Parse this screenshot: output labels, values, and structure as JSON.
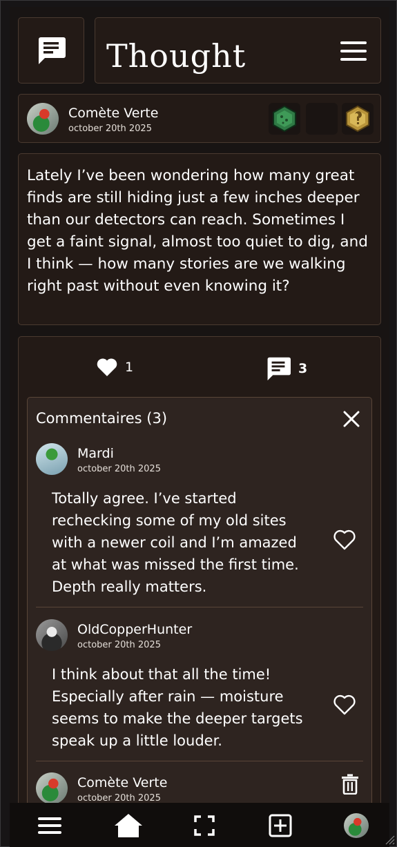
{
  "header": {
    "title": "Thought",
    "icon": "message-icon",
    "menu_icon": "hamburger-icon"
  },
  "post": {
    "author_name": "Comète Verte",
    "date": "october 20th 2025",
    "badges": [
      "green-badge-icon",
      "empty-badge-slot",
      "gold-badge-icon"
    ],
    "text": "Lately I’ve been wondering how many great finds are still hiding just a few inches deeper than our detectors can reach. Sometimes I get a faint signal, almost too quiet to dig, and I think — how many stories are we walking right past without even knowing it?",
    "likes": "1",
    "comments_count": "3"
  },
  "comments_panel": {
    "title": "Commentaires (3)",
    "comments": [
      {
        "author": "Mardi",
        "date": "october 20th 2025",
        "text": "Totally agree. I’ve started rechecking some of my old sites with a newer coil and I’m amazed at what was missed the first time. Depth really matters."
      },
      {
        "author": "OldCopperHunter",
        "date": "october 20th 2025",
        "text": "I think about that all the time! Especially after rain — moisture seems to make the deeper targets speak up a little louder."
      },
      {
        "author": "Comète Verte",
        "date": "october 20th 2025",
        "text": ""
      }
    ]
  },
  "bottom_nav": {
    "items": [
      "menu-icon",
      "home-icon",
      "fullscreen-icon",
      "add-icon",
      "profile-avatar"
    ]
  },
  "colors": {
    "background": "#181413",
    "panel": "#231a16",
    "panel_border": "#4a3a30",
    "comments_bg": "#2e2420",
    "text": "#ffffff"
  }
}
